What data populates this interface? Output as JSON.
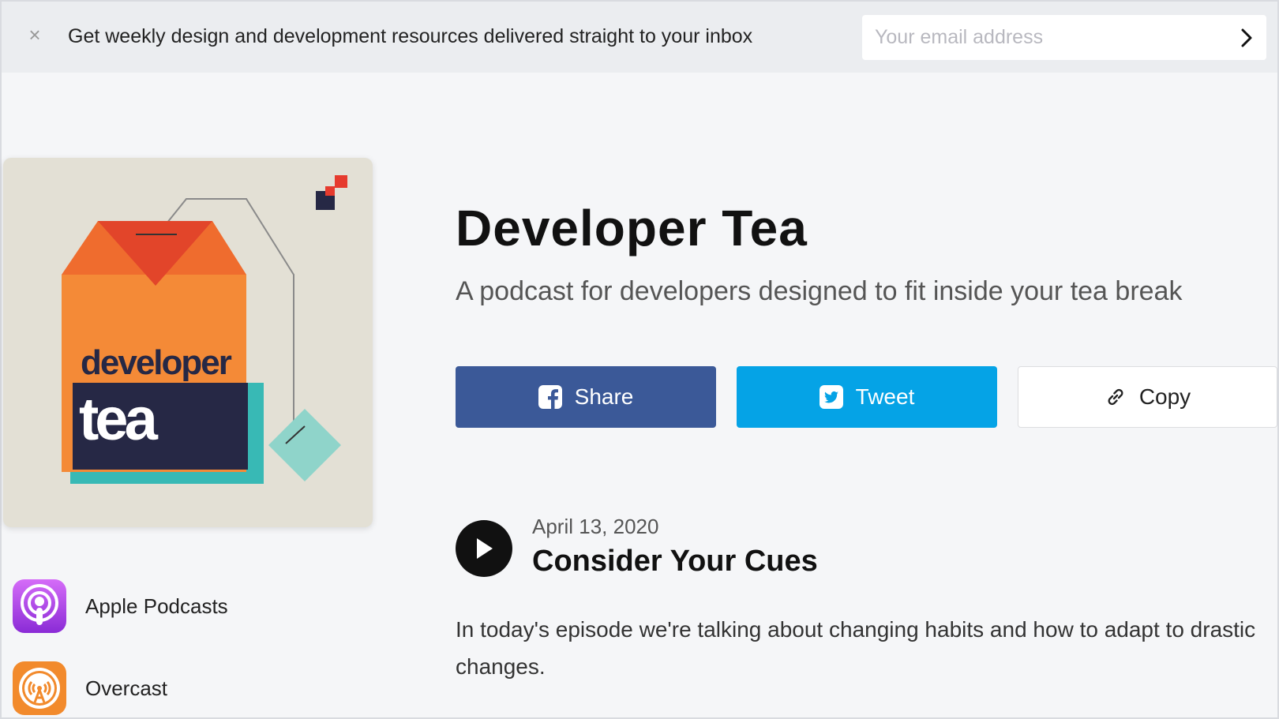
{
  "banner": {
    "close_icon": "close-icon",
    "text": "Get weekly design and development resources delivered straight to your inbox",
    "email_placeholder": "Your email address",
    "submit_icon": "chevron-right-icon"
  },
  "cover": {
    "line1": "developer",
    "line2": "tea"
  },
  "platforms": [
    {
      "label": "Apple Podcasts",
      "icon": "apple-podcasts-icon"
    },
    {
      "label": "Overcast",
      "icon": "overcast-icon"
    }
  ],
  "podcast": {
    "title": "Developer Tea",
    "subtitle": "A podcast for developers designed to fit inside your tea break"
  },
  "actions": {
    "share_label": "Share",
    "tweet_label": "Tweet",
    "copy_label": "Copy"
  },
  "episode": {
    "date": "April 13, 2020",
    "title": "Consider Your Cues",
    "description": "In today's episode we're talking about changing habits and how to adapt to drastic changes."
  },
  "colors": {
    "facebook": "#3b5998",
    "twitter": "#05a3e6",
    "background": "#f5f6f8"
  }
}
